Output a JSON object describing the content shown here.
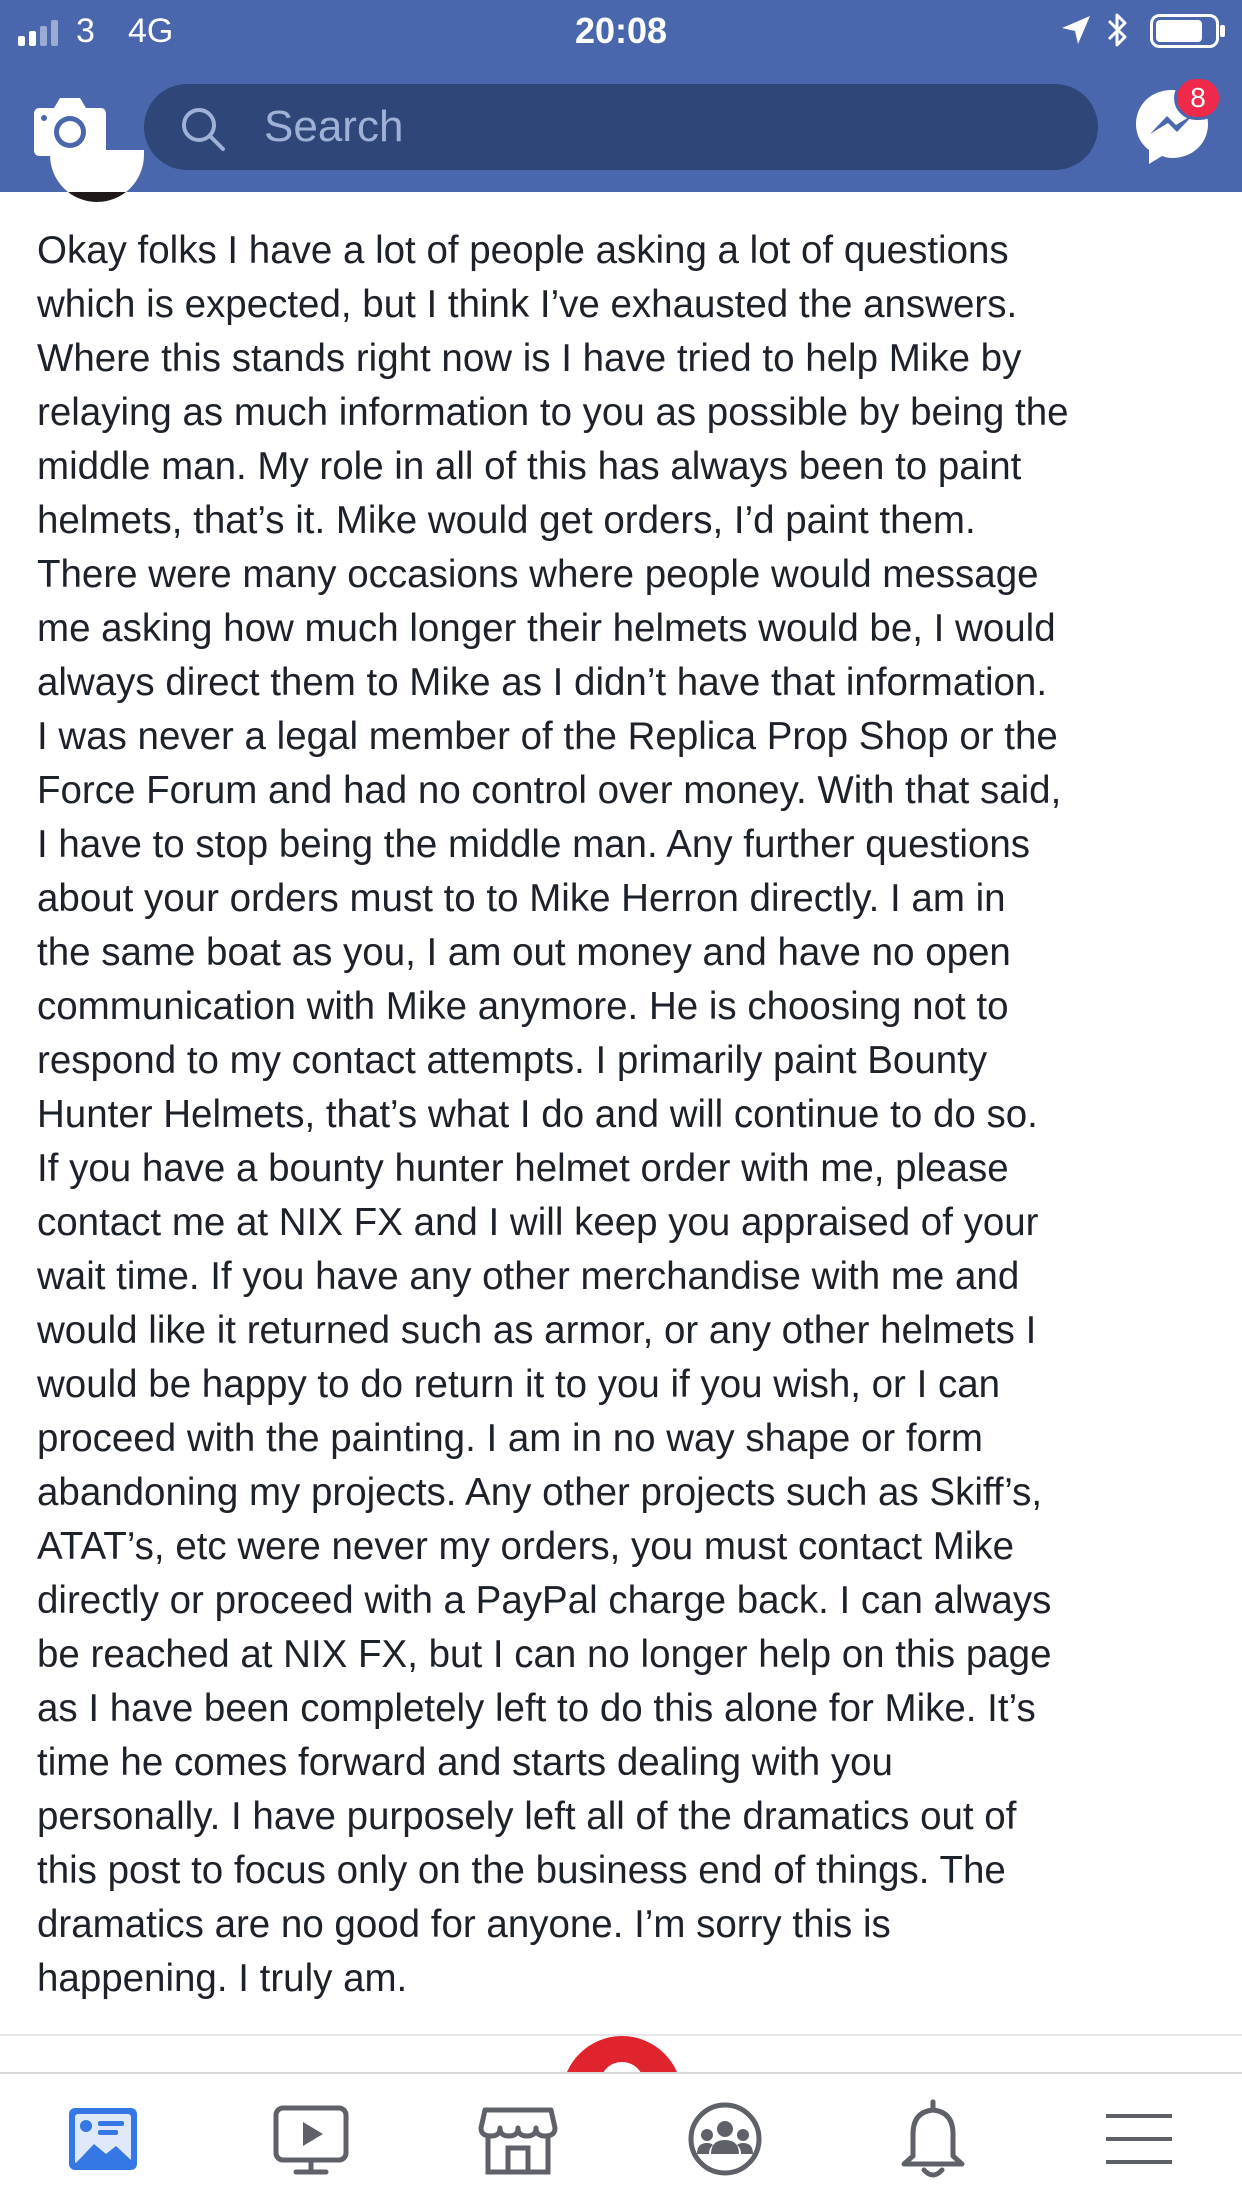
{
  "status_bar": {
    "carrier": "3",
    "network": "4G",
    "time": "20:08",
    "signal_bars": 2,
    "signal_bars_total": 4,
    "battery_level": 0.8,
    "icons": [
      "signal-icon",
      "location-arrow-icon",
      "bluetooth-icon",
      "battery-icon"
    ]
  },
  "header": {
    "camera_icon": "camera-icon",
    "search_placeholder": "Search",
    "search_icon": "search-icon",
    "messenger_icon": "messenger-icon",
    "messenger_badge": "8"
  },
  "post": {
    "text": "Okay folks I have a lot of people asking a lot of questions\nwhich is expected, but I think I’ve exhausted the answers.\nWhere this stands right now is I have tried to help Mike by\nrelaying as much information to you as possible by being the\nmiddle man. My role in all of this has always been to paint\nhelmets, that’s it. Mike would get orders, I’d paint them.\nThere were many occasions where people would message\nme asking how much longer their helmets would be, I would\nalways direct them to Mike as I didn’t have that information.\nI was never a legal member of the Replica Prop Shop or the\nForce Forum and had no control over money. With that said,\nI have to stop being the middle man. Any further questions\nabout your orders must to to Mike Herron directly. I am in\nthe same boat as you, I am out money and have no open\ncommunication with Mike anymore. He is choosing not to\nrespond to my contact attempts. I primarily paint Bounty\nHunter Helmets, that’s what I do and will continue to do so.\nIf you have a bounty hunter helmet order with me, please\ncontact me at NIX FX and I will keep you appraised of your\nwait time. If you have any other merchandise with me and\nwould like it returned such as armor, or any other helmets I\nwould be happy to do return it to you if you wish, or I can\nproceed with the painting. I am in no way shape or form\nabandoning my projects. Any other projects such as Skiff’s,\nATAT’s, etc were never my orders, you must contact Mike\ndirectly or proceed with a PayPal charge back. I can always\nbe reached at NIX FX, but I can no longer help on this page\nas I have been completely left to do this alone for Mike. It’s\ntime he comes forward and starts dealing with you\npersonally. I have purposely left all of the dramatics out of\nthis post to focus only on the business end of things. The\ndramatics are no good for anyone. I’m sorry this is\nhappening. I truly am."
  },
  "tab_bar": {
    "tabs": [
      {
        "icon": "news-feed-icon",
        "active": true
      },
      {
        "icon": "watch-video-icon",
        "active": false
      },
      {
        "icon": "marketplace-icon",
        "active": false
      },
      {
        "icon": "groups-icon",
        "active": false
      },
      {
        "icon": "notifications-bell-icon",
        "active": false
      },
      {
        "icon": "menu-icon",
        "active": false
      }
    ]
  },
  "colors": {
    "header_blue": "#4a67ad",
    "search_field": "#2e4678",
    "badge_red": "#f02849",
    "active_tab_blue": "#3578e5",
    "inactive_tab_gray": "#5e6268",
    "text": "#1d2129"
  }
}
